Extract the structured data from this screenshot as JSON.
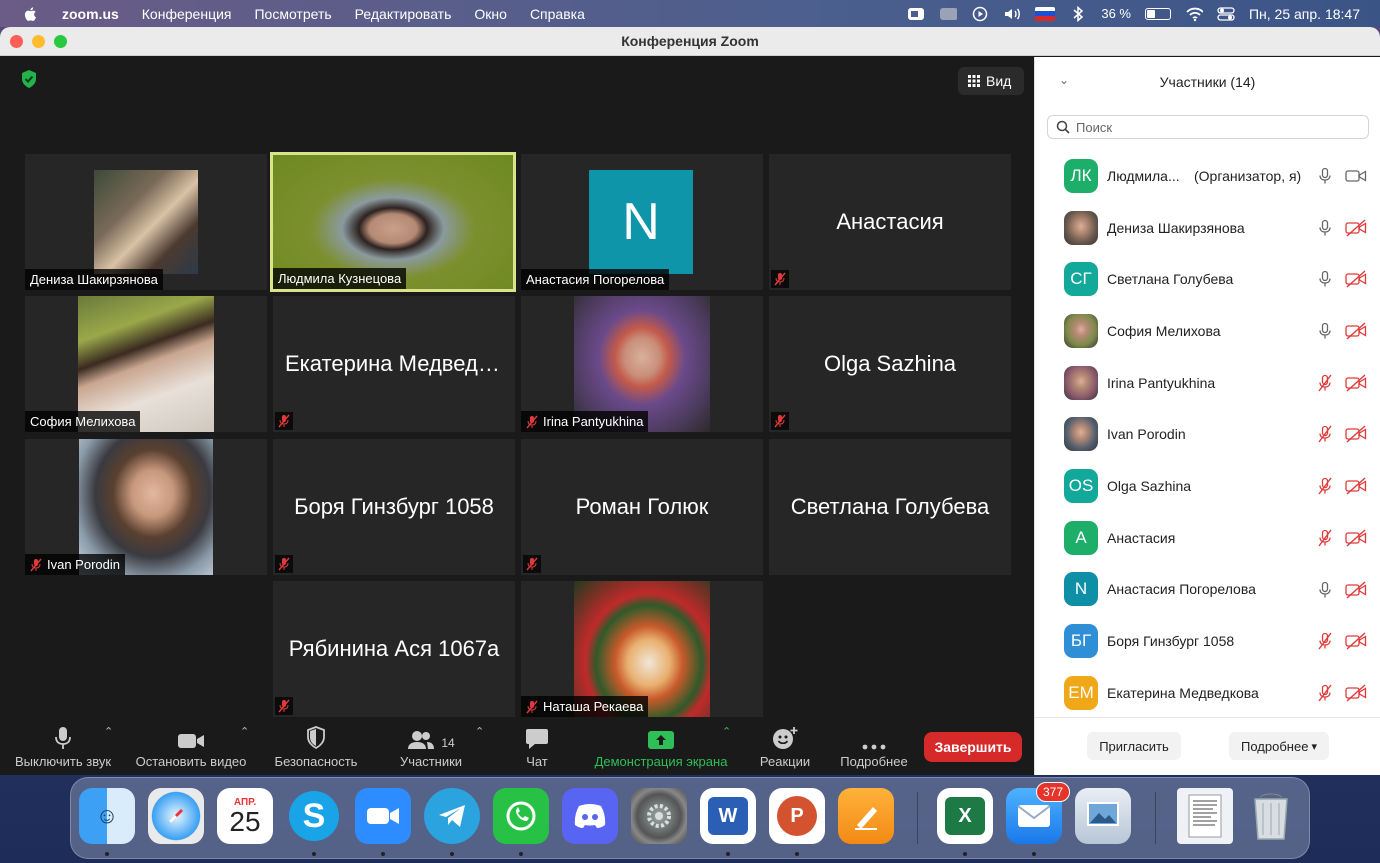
{
  "menubar": {
    "app": "zoom.us",
    "items": [
      "Конференция",
      "Посмотреть",
      "Редактировать",
      "Окно",
      "Справка"
    ],
    "battery": "36 %",
    "battery_level": 0.36,
    "datetime": "Пн, 25 апр.  18:47"
  },
  "window": {
    "title": "Конференция Zoom",
    "view_label": "Вид"
  },
  "tiles": [
    {
      "name": "Дениза Шакирзянова",
      "type": "photo",
      "muted": false,
      "active": false
    },
    {
      "name": "Людмила Кузнецова",
      "type": "photo",
      "muted": false,
      "active": true
    },
    {
      "name": "Анастасия Погорелова",
      "type": "avatar",
      "initial": "N",
      "muted": false,
      "active": false
    },
    {
      "name": "Анастасия",
      "type": "text",
      "muted": true
    },
    {
      "name": "София Мелихова",
      "type": "photo",
      "muted": false
    },
    {
      "name": "Екатерина Медведк...",
      "type": "text",
      "muted": true
    },
    {
      "name": "Irina Pantyukhina",
      "type": "photo",
      "muted": true
    },
    {
      "name": "Olga Sazhina",
      "type": "text",
      "muted": true
    },
    {
      "name": "Ivan Porodin",
      "type": "photo",
      "muted": true
    },
    {
      "name": "Боря Гинзбург 1058",
      "type": "text",
      "muted": true
    },
    {
      "name": "Роман Голюк",
      "type": "text",
      "muted": true
    },
    {
      "name": "Светлана Голубева",
      "type": "text",
      "muted": false
    },
    {
      "name": "Рябинина Ася 1067а",
      "type": "text",
      "muted": true
    },
    {
      "name": "Наташа Рекаева",
      "type": "photo",
      "muted": true
    }
  ],
  "toolbar": {
    "mute": "Выключить звук",
    "video": "Остановить видео",
    "security": "Безопасность",
    "participants": "Участники",
    "participants_count": "14",
    "chat": "Чат",
    "share": "Демонстрация экрана",
    "reactions": "Реакции",
    "more": "Подробнее",
    "end": "Завершить"
  },
  "panel": {
    "title": "Участники (14)",
    "search_placeholder": "Поиск",
    "invite": "Пригласить",
    "more": "Подробнее",
    "participants": [
      {
        "name": "Людмила...",
        "tag": "(Организатор, я)",
        "initials": "ЛК",
        "color": "#1dae6a",
        "mic": "on",
        "cam": "on"
      },
      {
        "name": "Дениза Шакирзянова",
        "initials": "",
        "color": "#6b5a4e",
        "mic": "on",
        "cam": "off"
      },
      {
        "name": "Светлана Голубева",
        "initials": "СГ",
        "color": "#12a89a",
        "mic": "on",
        "cam": "off"
      },
      {
        "name": "София Мелихова",
        "initials": "",
        "color": "#7d8a4a",
        "mic": "on",
        "cam": "off"
      },
      {
        "name": "Irina Pantyukhina",
        "initials": "",
        "color": "#8c5a6e",
        "mic": "off",
        "cam": "off"
      },
      {
        "name": "Ivan Porodin",
        "initials": "",
        "color": "#556070",
        "mic": "off",
        "cam": "off"
      },
      {
        "name": "Olga Sazhina",
        "initials": "OS",
        "color": "#12a89a",
        "mic": "off",
        "cam": "off"
      },
      {
        "name": "Анастасия",
        "initials": "А",
        "color": "#1dae6a",
        "mic": "off",
        "cam": "off"
      },
      {
        "name": "Анастасия Погорелова",
        "initials": "N",
        "color": "#0f8fa5",
        "mic": "on",
        "cam": "off"
      },
      {
        "name": "Боря Гинзбург 1058",
        "initials": "БГ",
        "color": "#2e8fd6",
        "mic": "off",
        "cam": "off"
      },
      {
        "name": "Екатерина Медведкова",
        "initials": "ЕМ",
        "color": "#f0a818",
        "mic": "off",
        "cam": "off"
      }
    ]
  },
  "dock": {
    "calendar_month": "АПР.",
    "calendar_day": "25",
    "mail_badge": "377",
    "apps": [
      "finder-icon",
      "safari-icon",
      "calendar-icon",
      "skype-icon",
      "zoom-icon",
      "telegram-icon",
      "whatsapp-icon",
      "discord-icon",
      "system-preferences-icon",
      "word-icon",
      "powerpoint-icon",
      "pages-icon",
      "excel-icon",
      "mail-icon",
      "preview-icon",
      "document-icon",
      "trash-icon"
    ]
  }
}
